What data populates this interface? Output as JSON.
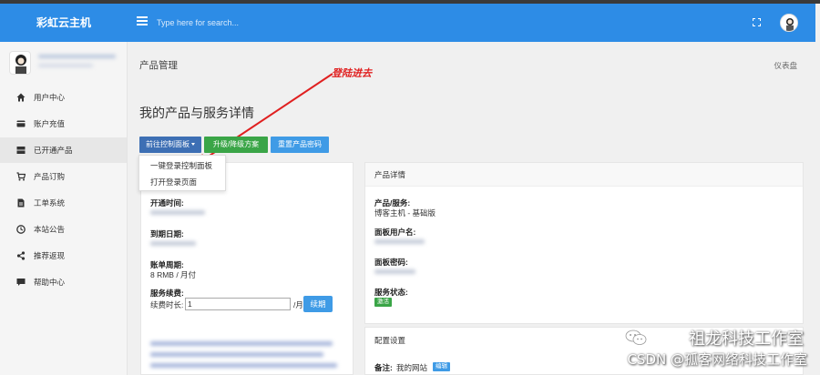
{
  "header": {
    "brand": "彩虹云主机",
    "search_placeholder": "Type here for search..."
  },
  "sidebar": {
    "items": [
      {
        "label": "用户中心",
        "icon": "home-icon"
      },
      {
        "label": "账户充值",
        "icon": "credit-card-icon"
      },
      {
        "label": "已开通产品",
        "icon": "server-icon"
      },
      {
        "label": "产品订购",
        "icon": "cart-icon"
      },
      {
        "label": "工单系统",
        "icon": "document-icon"
      },
      {
        "label": "本站公告",
        "icon": "clock-icon"
      },
      {
        "label": "推荐返现",
        "icon": "share-icon"
      },
      {
        "label": "帮助中心",
        "icon": "chat-icon"
      }
    ],
    "active_index": 2
  },
  "page": {
    "header": "产品管理",
    "breadcrumb": "仪表盘",
    "annotation": "登陆进去",
    "title": "我的产品与服务详情"
  },
  "actions": {
    "control_panel": "前往控制面板",
    "upgrade": "升级/降级方案",
    "reset_password": "重置产品密码"
  },
  "dropdown": {
    "items": [
      "一键登录控制面板",
      "打开登录页面"
    ]
  },
  "left_panel": {
    "open_time_label": "开通时间:",
    "expire_label": "到期日期:",
    "billing_cycle_label": "账单周期:",
    "billing_cycle_value": "8 RMB / 月付",
    "renew_label": "服务续费:",
    "renew_duration_label": "续费时长:",
    "renew_value": "1",
    "renew_unit": "/月",
    "renew_button": "续期"
  },
  "right_panel": {
    "heading": "产品详情",
    "product_label": "产品/服务:",
    "product_value": "博客主机 - 基础版",
    "panel_user_label": "面板用户名:",
    "panel_password_label": "面板密码:",
    "status_label": "服务状态:",
    "status_value": "激活"
  },
  "config_panel": {
    "heading": "配置设置",
    "note_label": "备注:",
    "note_value": "我的网站",
    "edit_button": "编辑"
  },
  "watermark": {
    "line1": "祖龙科技工作室",
    "line2": "CSDN @孤客网络科技工作室"
  },
  "colors": {
    "topbar": "#2d8ce6",
    "primary": "#3d6fb4",
    "success": "#3aa547",
    "info": "#3f9be6",
    "annotation": "#e02020"
  }
}
